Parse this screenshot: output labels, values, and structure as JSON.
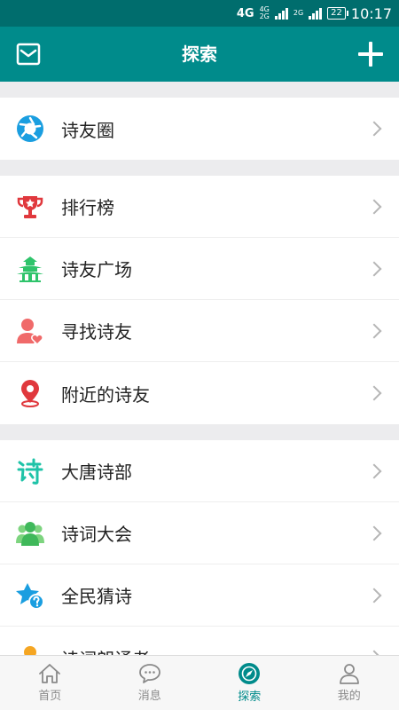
{
  "status": {
    "net1": "4G",
    "net2_top": "4G",
    "net2_bottom": "2G",
    "net3": "2G",
    "battery": "22",
    "time": "10:17"
  },
  "header": {
    "title": "探索",
    "left_icon": "mail-icon",
    "right_icon": "plus-icon"
  },
  "groups": [
    {
      "items": [
        {
          "label": "诗友圈",
          "icon": "aperture-icon"
        }
      ]
    },
    {
      "items": [
        {
          "label": "排行榜",
          "icon": "trophy-icon"
        },
        {
          "label": "诗友广场",
          "icon": "pavilion-icon"
        },
        {
          "label": "寻找诗友",
          "icon": "person-heart-icon"
        },
        {
          "label": "附近的诗友",
          "icon": "location-pin-icon"
        }
      ]
    },
    {
      "items": [
        {
          "label": "大唐诗部",
          "icon": "shi-character-icon"
        },
        {
          "label": "诗词大会",
          "icon": "group-people-icon"
        },
        {
          "label": "全民猜诗",
          "icon": "star-question-icon"
        },
        {
          "label": "诗词朗诵者",
          "icon": "person-icon"
        }
      ]
    }
  ],
  "tabs": [
    {
      "label": "首页",
      "icon": "home-icon"
    },
    {
      "label": "消息",
      "icon": "chat-bubble-icon"
    },
    {
      "label": "探索",
      "icon": "compass-icon",
      "active": true
    },
    {
      "label": "我的",
      "icon": "user-icon"
    }
  ],
  "colors": {
    "primary": "#008b8b",
    "statusbar": "#006d6d",
    "background": "#ececee"
  }
}
